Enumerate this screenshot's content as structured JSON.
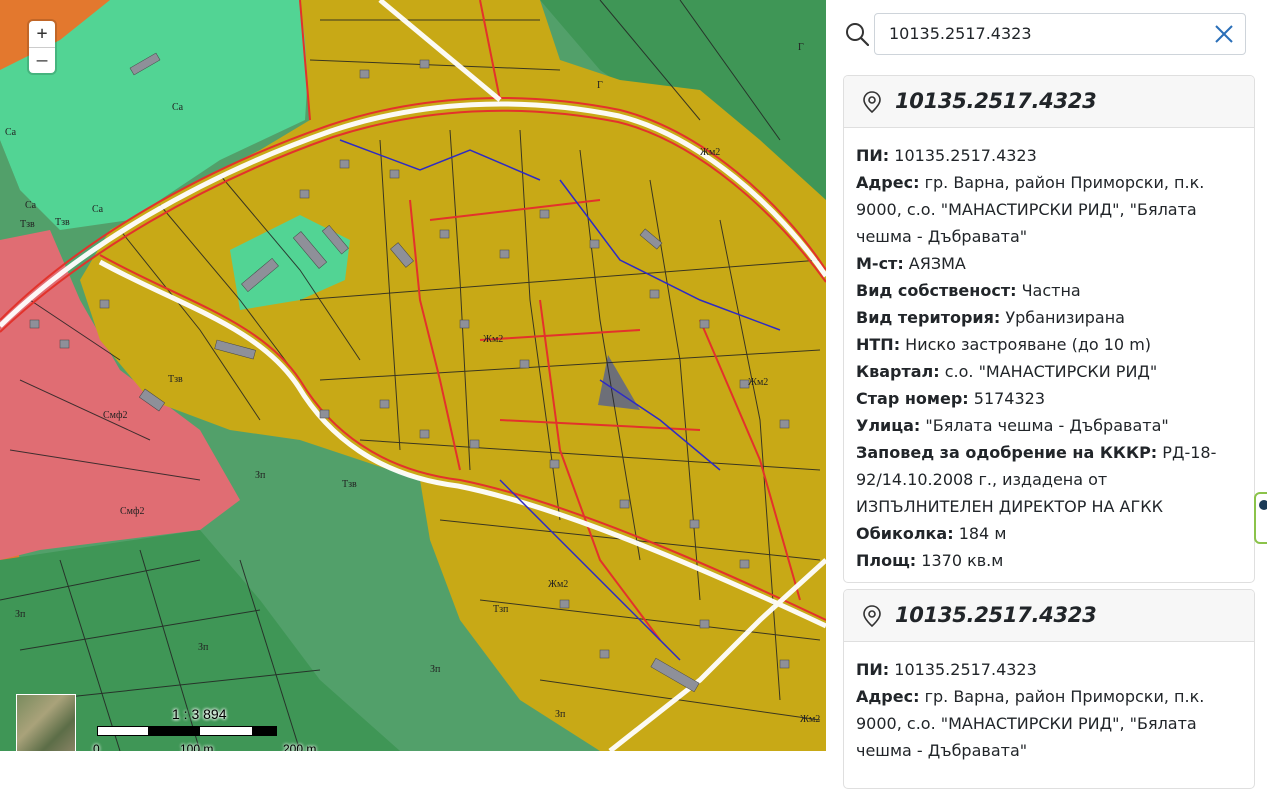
{
  "map": {
    "zoom_in_label": "+",
    "zoom_out_label": "–",
    "scale_label": "1 : 3 894",
    "scale_ticks": [
      "0",
      "100 m",
      "200 m"
    ],
    "zone_labels": [
      "Са",
      "Са",
      "Са",
      "Са",
      "Тзв",
      "Тзв",
      "Тзв",
      "Тзв",
      "Жм2",
      "Жм2",
      "Жм2",
      "Жм2",
      "Жм2",
      "Смф2",
      "Смф2",
      "Зп",
      "Зп",
      "Зп",
      "Зп",
      "Зп",
      "Тзп",
      "Г",
      "Г"
    ],
    "colors": {
      "residential": "#c8a916",
      "green": "#52a06a",
      "mint": "#52d494",
      "pink": "#e06d73",
      "orange": "#e3782e",
      "parcel_line": "#222222",
      "road_red": "#e3322b",
      "blue_line": "#2e2bc4"
    }
  },
  "search": {
    "value": "10135.2517.4323",
    "placeholder": ""
  },
  "cards": [
    {
      "title": "10135.2517.4323",
      "fields": [
        {
          "label": "ПИ:",
          "value": "10135.2517.4323"
        },
        {
          "label": "Адрес:",
          "value": "гр. Варна, район Приморски, п.к. 9000, с.о. \"МАНАСТИРСКИ РИД\", \"Бялата чешма - Дъбравата\""
        },
        {
          "label": "М-ст:",
          "value": "АЯЗМА"
        },
        {
          "label": "Вид собственост:",
          "value": "Частна"
        },
        {
          "label": "Вид територия:",
          "value": "Урбанизирана"
        },
        {
          "label": "НТП:",
          "value": "Ниско застрояване (до 10 m)"
        },
        {
          "label": "Квартал:",
          "value": "с.о. \"МАНАСТИРСКИ РИД\""
        },
        {
          "label": "Стар номер:",
          "value": "5174323"
        },
        {
          "label": "Улица:",
          "value": "\"Бялата чешма - Дъбравата\""
        },
        {
          "label": "Заповед за одобрение на КККР:",
          "value": "РД-18-92/14.10.2008 г., издадена от ИЗПЪЛНИТЕЛЕН ДИРЕКТОР НА АГКК"
        },
        {
          "label": "Обиколка:",
          "value": "184 м"
        },
        {
          "label": "Площ:",
          "value": "1370 кв.м"
        }
      ]
    },
    {
      "title": "10135.2517.4323",
      "fields": [
        {
          "label": "ПИ:",
          "value": "10135.2517.4323"
        },
        {
          "label": "Адрес:",
          "value": "гр. Варна, район Приморски, п.к. 9000, с.о. \"МАНАСТИРСКИ РИД\", \"Бялата чешма - Дъбравата\""
        }
      ]
    }
  ]
}
